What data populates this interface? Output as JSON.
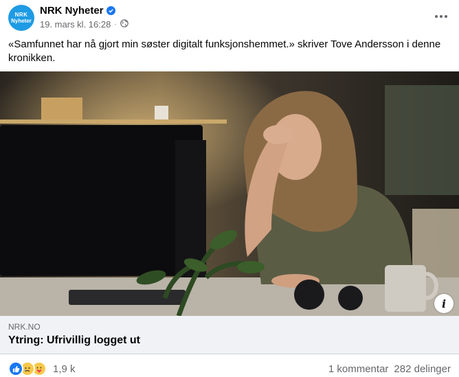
{
  "post": {
    "page_name": "NRK Nyheter",
    "avatar_text": [
      "NRK",
      "Nyheter"
    ],
    "timestamp": "19. mars kl. 16:28",
    "caption": "«Samfunnet har nå gjort min søster digitalt funksjonshemmet.» skriver Tove Andersson i denne kronikken."
  },
  "link_preview": {
    "domain": "NRK.NO",
    "title": "Ytring: Ufrivillig logget ut"
  },
  "footer": {
    "reaction_count": "1,9 k",
    "comments": "1 kommentar",
    "shares": "282 delinger"
  },
  "colors": {
    "accent": "#1877f2",
    "nrk_blue": "#1e9be4",
    "secondary_text": "#65676b",
    "link_bg": "#f0f2f5"
  },
  "icons": {
    "verified": "verified-badge-icon",
    "audience": "globe-icon",
    "menu": "more-options-icon",
    "info": "info-icon",
    "reactions": [
      "like-icon",
      "sad-icon",
      "care-icon"
    ]
  }
}
